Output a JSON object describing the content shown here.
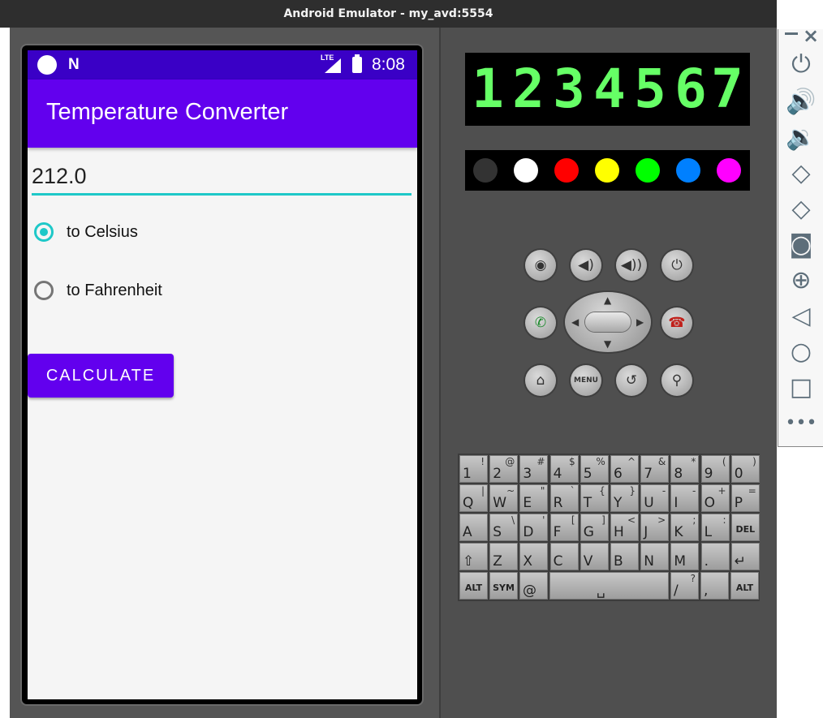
{
  "window": {
    "title": "Android Emulator - my_avd:5554"
  },
  "statusbar": {
    "network": "LTE",
    "time": "8:08"
  },
  "app": {
    "title": "Temperature Converter",
    "input_value": "212.0",
    "radios": [
      {
        "label": "to Celsius",
        "checked": true
      },
      {
        "label": "to Fahrenheit",
        "checked": false
      }
    ],
    "button_label": "CALCULATE"
  },
  "skin": {
    "digits": [
      "1",
      "2",
      "3",
      "4",
      "5",
      "6",
      "7"
    ],
    "color_dots": [
      "#333333",
      "#ffffff",
      "#ff0000",
      "#ffff00",
      "#00ff00",
      "#0080ff",
      "#ff00ff"
    ],
    "icons": [
      "camera-icon",
      "volume-down-icon",
      "volume-up-icon",
      "power-icon",
      "call-icon",
      "end-call-icon",
      "home-icon",
      "menu-icon",
      "back-icon",
      "search-icon"
    ],
    "menu_label": "MENU"
  },
  "keyboard": {
    "row1": [
      [
        "1",
        "!"
      ],
      [
        "2",
        "@"
      ],
      [
        "3",
        "#"
      ],
      [
        "4",
        "$"
      ],
      [
        "5",
        "%"
      ],
      [
        "6",
        "^"
      ],
      [
        "7",
        "&"
      ],
      [
        "8",
        "*"
      ],
      [
        "9",
        "("
      ],
      [
        "0",
        ")"
      ]
    ],
    "row2": [
      [
        "Q",
        "|"
      ],
      [
        "W",
        "~"
      ],
      [
        "E",
        "\""
      ],
      [
        "R",
        "`"
      ],
      [
        "T",
        "{"
      ],
      [
        "Y",
        "}"
      ],
      [
        "U",
        "-"
      ],
      [
        "I",
        "-"
      ],
      [
        "O",
        "+"
      ],
      [
        "P",
        "="
      ]
    ],
    "row3": [
      [
        "A",
        ""
      ],
      [
        "S",
        "\\"
      ],
      [
        "D",
        "'"
      ],
      [
        "F",
        "["
      ],
      [
        "G",
        "]"
      ],
      [
        "H",
        "<"
      ],
      [
        "J",
        ">"
      ],
      [
        "K",
        ";"
      ],
      [
        "L",
        ":"
      ],
      [
        "DEL",
        ""
      ]
    ],
    "row4": [
      [
        "⇧",
        ""
      ],
      [
        "Z",
        ""
      ],
      [
        "X",
        ""
      ],
      [
        "C",
        ""
      ],
      [
        "V",
        ""
      ],
      [
        "B",
        ""
      ],
      [
        "N",
        ""
      ],
      [
        "M",
        ""
      ],
      [
        ".",
        ""
      ],
      [
        "↵",
        ""
      ]
    ],
    "row5": [
      [
        "ALT",
        ""
      ],
      [
        "SYM",
        ""
      ],
      [
        "@",
        ""
      ],
      [
        "␣",
        ""
      ],
      [
        "/",
        "?"
      ],
      [
        ",",
        ""
      ],
      [
        "ALT",
        ""
      ]
    ]
  }
}
